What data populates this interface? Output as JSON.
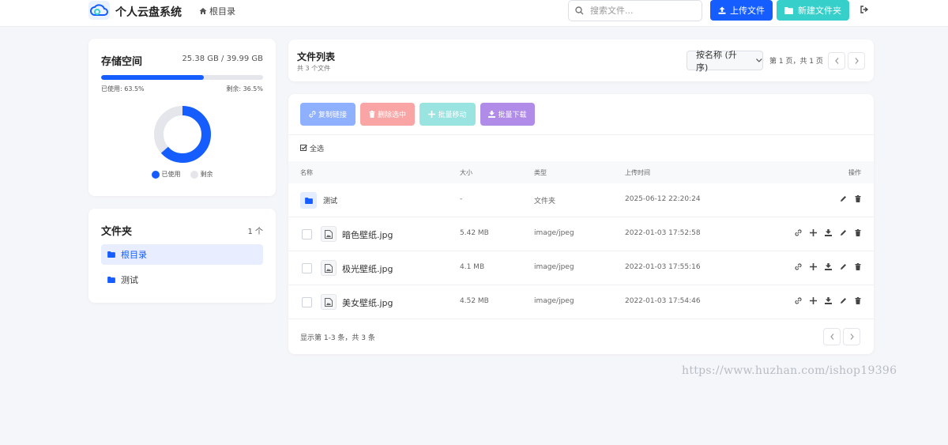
{
  "app": {
    "title": "个人云盘系统",
    "breadcrumb": "根目录"
  },
  "header": {
    "search_placeholder": "搜索文件...",
    "upload_label": "上传文件",
    "new_folder_label": "新建文件夹"
  },
  "storage": {
    "title": "存储空间",
    "amount": "25.38 GB / 39.99 GB",
    "used_fraction": 0.635,
    "used_label": "已使用: 63.5%",
    "free_label": "剩余: 36.5%",
    "legend_used": "已使用",
    "legend_free": "剩余"
  },
  "folders": {
    "title": "文件夹",
    "count": "1 个",
    "items": [
      {
        "label": "根目录",
        "active": true
      },
      {
        "label": "测试",
        "active": false
      }
    ]
  },
  "file_list": {
    "title": "文件列表",
    "subtitle": "共 3 个文件",
    "sort_label": "按名称 (升序)",
    "page_info": "第 1 页，共 1 页"
  },
  "bulk_actions": {
    "copy_link": "复制链接",
    "delete_selected": "删除选中",
    "batch_move": "批量移动",
    "batch_download": "批量下载",
    "select_all": "全选"
  },
  "table": {
    "headers": [
      "名称",
      "大小",
      "类型",
      "上传时间",
      "操作"
    ],
    "rows": [
      {
        "name": "测试",
        "size": "-",
        "type": "文件夹",
        "time": "2025-06-12 22:20:24",
        "kind": "folder"
      },
      {
        "name": "暗色壁纸.jpg",
        "size": "5.42 MB",
        "type": "image/jpeg",
        "time": "2022-01-03 17:52:58",
        "kind": "file"
      },
      {
        "name": "极光壁纸.jpg",
        "size": "4.1 MB",
        "type": "image/jpeg",
        "time": "2022-01-03 17:55:16",
        "kind": "file"
      },
      {
        "name": "美女壁纸.jpg",
        "size": "4.52 MB",
        "type": "image/jpeg",
        "time": "2022-01-03 17:54:46",
        "kind": "file"
      }
    ],
    "footer": "显示第 1-3 条，共 3 条"
  },
  "watermark": "https://www.huzhan.com/ishop19396",
  "colors": {
    "primary": "#165dff",
    "teal": "#36cfc9",
    "track": "#e4e6eb"
  }
}
